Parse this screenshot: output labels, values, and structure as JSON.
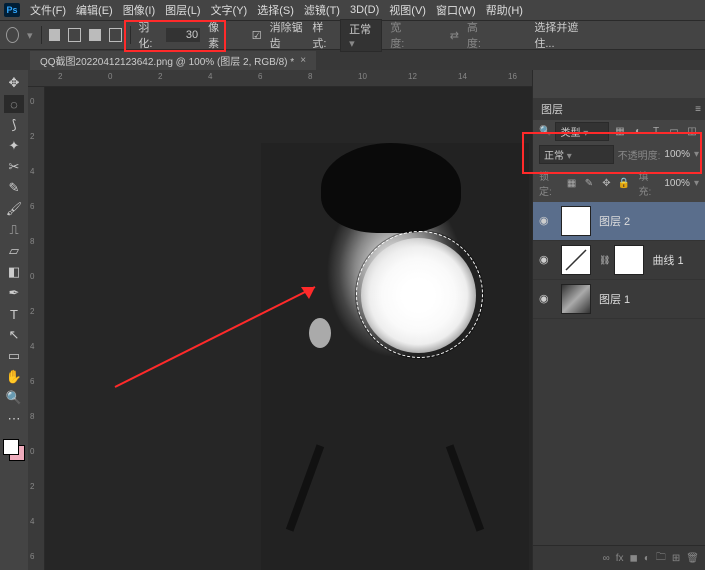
{
  "menubar": {
    "items": [
      "文件(F)",
      "编辑(E)",
      "图像(I)",
      "图层(L)",
      "文字(Y)",
      "选择(S)",
      "滤镜(T)",
      "3D(D)",
      "视图(V)",
      "窗口(W)",
      "帮助(H)"
    ]
  },
  "optbar": {
    "feather_label": "羽化:",
    "feather_value": "30",
    "feather_unit": "像素",
    "antialias": "消除锯齿",
    "style_label": "样式:",
    "style_value": "正常",
    "width_label": "宽度:",
    "height_label": "高度:",
    "select_mask": "选择并遮住..."
  },
  "tab": {
    "title": "QQ截图20220412123642.png @ 100% (图层 2, RGB/8) *"
  },
  "ruler_h": [
    "2",
    "0",
    "2",
    "4",
    "6",
    "8",
    "10",
    "12",
    "14",
    "16"
  ],
  "ruler_v": [
    "0",
    "2",
    "4",
    "6",
    "8",
    "0",
    "2",
    "4",
    "6",
    "8",
    "0",
    "2",
    "4",
    "6"
  ],
  "layerspanel": {
    "title": "图层",
    "kind_label": "类型",
    "mode": "正常",
    "opacity_label": "不透明度:",
    "opacity_value": "100%",
    "lock_label": "锁定:",
    "fill_label": "填充:",
    "fill_value": "100%",
    "layers": [
      {
        "name": "图层 2",
        "active": true,
        "kind": "pixel"
      },
      {
        "name": "曲线 1",
        "active": false,
        "kind": "curves"
      },
      {
        "name": "图层 1",
        "active": false,
        "kind": "image"
      }
    ],
    "foot": {
      "link": "∞",
      "fx": "fx"
    }
  },
  "icons": {
    "search": "🔍",
    "eye": "👁",
    "drop": "▾",
    "menu": "≡",
    "close": "×"
  }
}
